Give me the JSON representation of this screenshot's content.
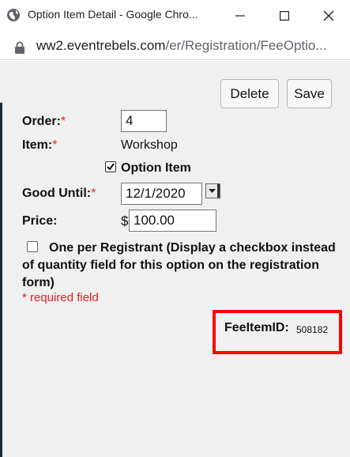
{
  "window": {
    "title": "Option Item Detail - Google Chro...",
    "url_domain": "ww2.eventrebels.com",
    "url_path": "/er/Registration/FeeOptio..."
  },
  "toolbar": {
    "delete_label": "Delete",
    "save_label": "Save"
  },
  "form": {
    "order_label": "Order:",
    "order_value": "4",
    "item_label": "Item:",
    "item_value": "Workshop",
    "option_item_label": "Option Item",
    "option_item_checked": true,
    "good_until_label": "Good Until:",
    "good_until_value": "12/1/2020",
    "price_label": "Price:",
    "price_currency": "$",
    "price_value": "100.00",
    "one_per_registrant_checked": false,
    "one_per_registrant_label": "One per Registrant (Display a checkbox instead of quantity field for this option on the registration form)",
    "required_marker": "*",
    "required_note": "* required field"
  },
  "fee_item": {
    "label": "FeeItemID:",
    "value": "508182"
  },
  "colors": {
    "required": "#e32020",
    "highlight_box": "#ff0000",
    "content_bg": "#f0f0f0"
  }
}
